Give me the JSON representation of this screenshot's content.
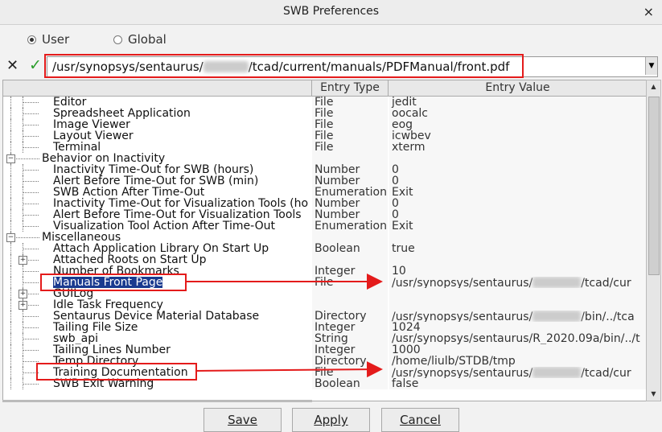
{
  "window": {
    "title": "SWB Preferences",
    "close_label": "×"
  },
  "scope": {
    "user_label": "User",
    "global_label": "Global",
    "selected": "User"
  },
  "path": {
    "cancel_label": "✕",
    "accept_label": "✓",
    "prefix": "/usr/synopsys/sentaurus/",
    "suffix": "/tcad/current/manuals/PDFManual/front.pdf"
  },
  "columns": {
    "entry_type": "Entry Type",
    "entry_value": "Entry Value"
  },
  "rows": [
    {
      "label": "Editor",
      "type": "File",
      "value": "jedit"
    },
    {
      "label": "Spreadsheet Application",
      "type": "File",
      "value": "oocalc"
    },
    {
      "label": "Image Viewer",
      "type": "File",
      "value": "eog"
    },
    {
      "label": "Layout Viewer",
      "type": "File",
      "value": "icwbev"
    },
    {
      "label": "Terminal",
      "type": "File",
      "value": "xterm"
    },
    {
      "label": "Behavior on Inactivity",
      "type": "",
      "value": ""
    },
    {
      "label": "Inactivity Time-Out for SWB (hours)",
      "type": "Number",
      "value": "0"
    },
    {
      "label": "Alert Before Time-Out for SWB (min)",
      "type": "Number",
      "value": "0"
    },
    {
      "label": "SWB Action After Time-Out",
      "type": "Enumeration",
      "value": "Exit"
    },
    {
      "label": "Inactivity Time-Out for Visualization Tools (ho",
      "type": "Number",
      "value": "0"
    },
    {
      "label": "Alert Before Time-Out for Visualization Tools",
      "type": "Number",
      "value": "0"
    },
    {
      "label": "Visualization Tool Action After Time-Out",
      "type": "Enumeration",
      "value": "Exit"
    },
    {
      "label": "Miscellaneous",
      "type": "",
      "value": ""
    },
    {
      "label": "Attach Application Library On Start Up",
      "type": "Boolean",
      "value": "true"
    },
    {
      "label": "Attached Roots on Start Up",
      "type": "",
      "value": ""
    },
    {
      "label": "Number of Bookmarks",
      "type": "Integer",
      "value": "10"
    },
    {
      "label": "Manuals Front Page",
      "type": "File",
      "value": "/usr/synopsys/sentaurus/",
      "value_suffix": "/tcad/cur"
    },
    {
      "label": "GUILog",
      "type": "",
      "value": ""
    },
    {
      "label": "Idle Task Frequency",
      "type": "",
      "value": ""
    },
    {
      "label": "Sentaurus Device Material Database",
      "type": "Directory",
      "value": "/usr/synopsys/sentaurus/",
      "value_suffix": "/bin/../tca"
    },
    {
      "label": "Tailing File Size",
      "type": "Integer",
      "value": "1024"
    },
    {
      "label": "swb_api",
      "type": "String",
      "value": "/usr/synopsys/sentaurus/R_2020.09a/bin/../t"
    },
    {
      "label": "Tailing Lines Number",
      "type": "Integer",
      "value": "1000"
    },
    {
      "label": "Temp Directory",
      "type": "Directory",
      "value": "/home/liulb/STDB/tmp"
    },
    {
      "label": "Training Documentation",
      "type": "File",
      "value": "/usr/synopsys/sentaurus/",
      "value_suffix": "/tcad/cur"
    },
    {
      "label": "SWB Exit Warning",
      "type": "Boolean",
      "value": "false"
    }
  ],
  "buttons": {
    "save": "Save",
    "apply": "Apply",
    "cancel": "Cancel"
  },
  "colors": {
    "annotation": "#e41b1b",
    "selection": "#1a3a8f",
    "accept": "#2a9d2a"
  }
}
